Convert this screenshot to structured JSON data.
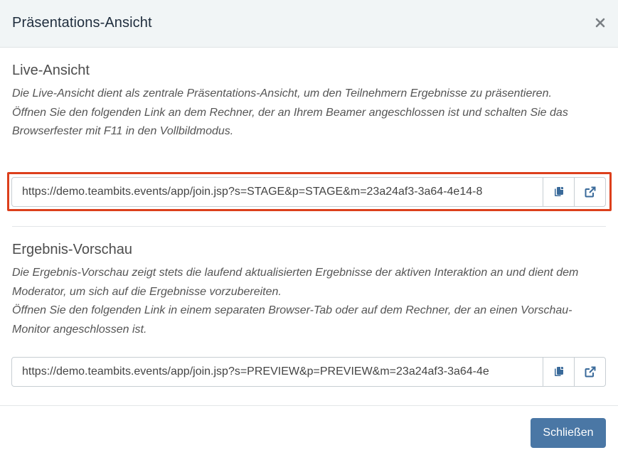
{
  "modal": {
    "title": "Präsentations-Ansicht",
    "close_icon": "close-icon"
  },
  "live": {
    "title": "Live-Ansicht",
    "desc_1": "Die Live-Ansicht dient als zentrale Präsentations-Ansicht, um den Teilnehmern Ergebnisse zu präsentieren.",
    "desc_2": "Öffnen Sie den folgenden Link an dem Rechner, der an Ihrem Beamer angeschlossen ist und schalten Sie das Browserfester mit F11 in den Vollbildmodus.",
    "url": "https://demo.teambits.events/app/join.jsp?s=STAGE&p=STAGE&m=23a24af3-3a64-4e14-8",
    "copy_icon": "copy-icon",
    "open_icon": "external-link-icon"
  },
  "preview": {
    "title": "Ergebnis-Vorschau",
    "desc_1": "Die Ergebnis-Vorschau zeigt stets die laufend aktualisierten Ergebnisse der aktiven Interaktion an und dient dem Moderator, um sich auf die Ergebnisse vorzubereiten.",
    "desc_2": "Öffnen Sie den folgenden Link in einem separaten Browser-Tab oder auf dem Rechner, der an einen Vorschau-Monitor angeschlossen ist.",
    "url": "https://demo.teambits.events/app/join.jsp?s=PREVIEW&p=PREVIEW&m=23a24af3-3a64-4e",
    "copy_icon": "copy-icon",
    "open_icon": "external-link-icon"
  },
  "footer": {
    "close_label": "Schließen"
  },
  "colors": {
    "header_bg": "#f1f5f6",
    "primary": "#4a77a5",
    "highlight": "#dc3f1c"
  }
}
